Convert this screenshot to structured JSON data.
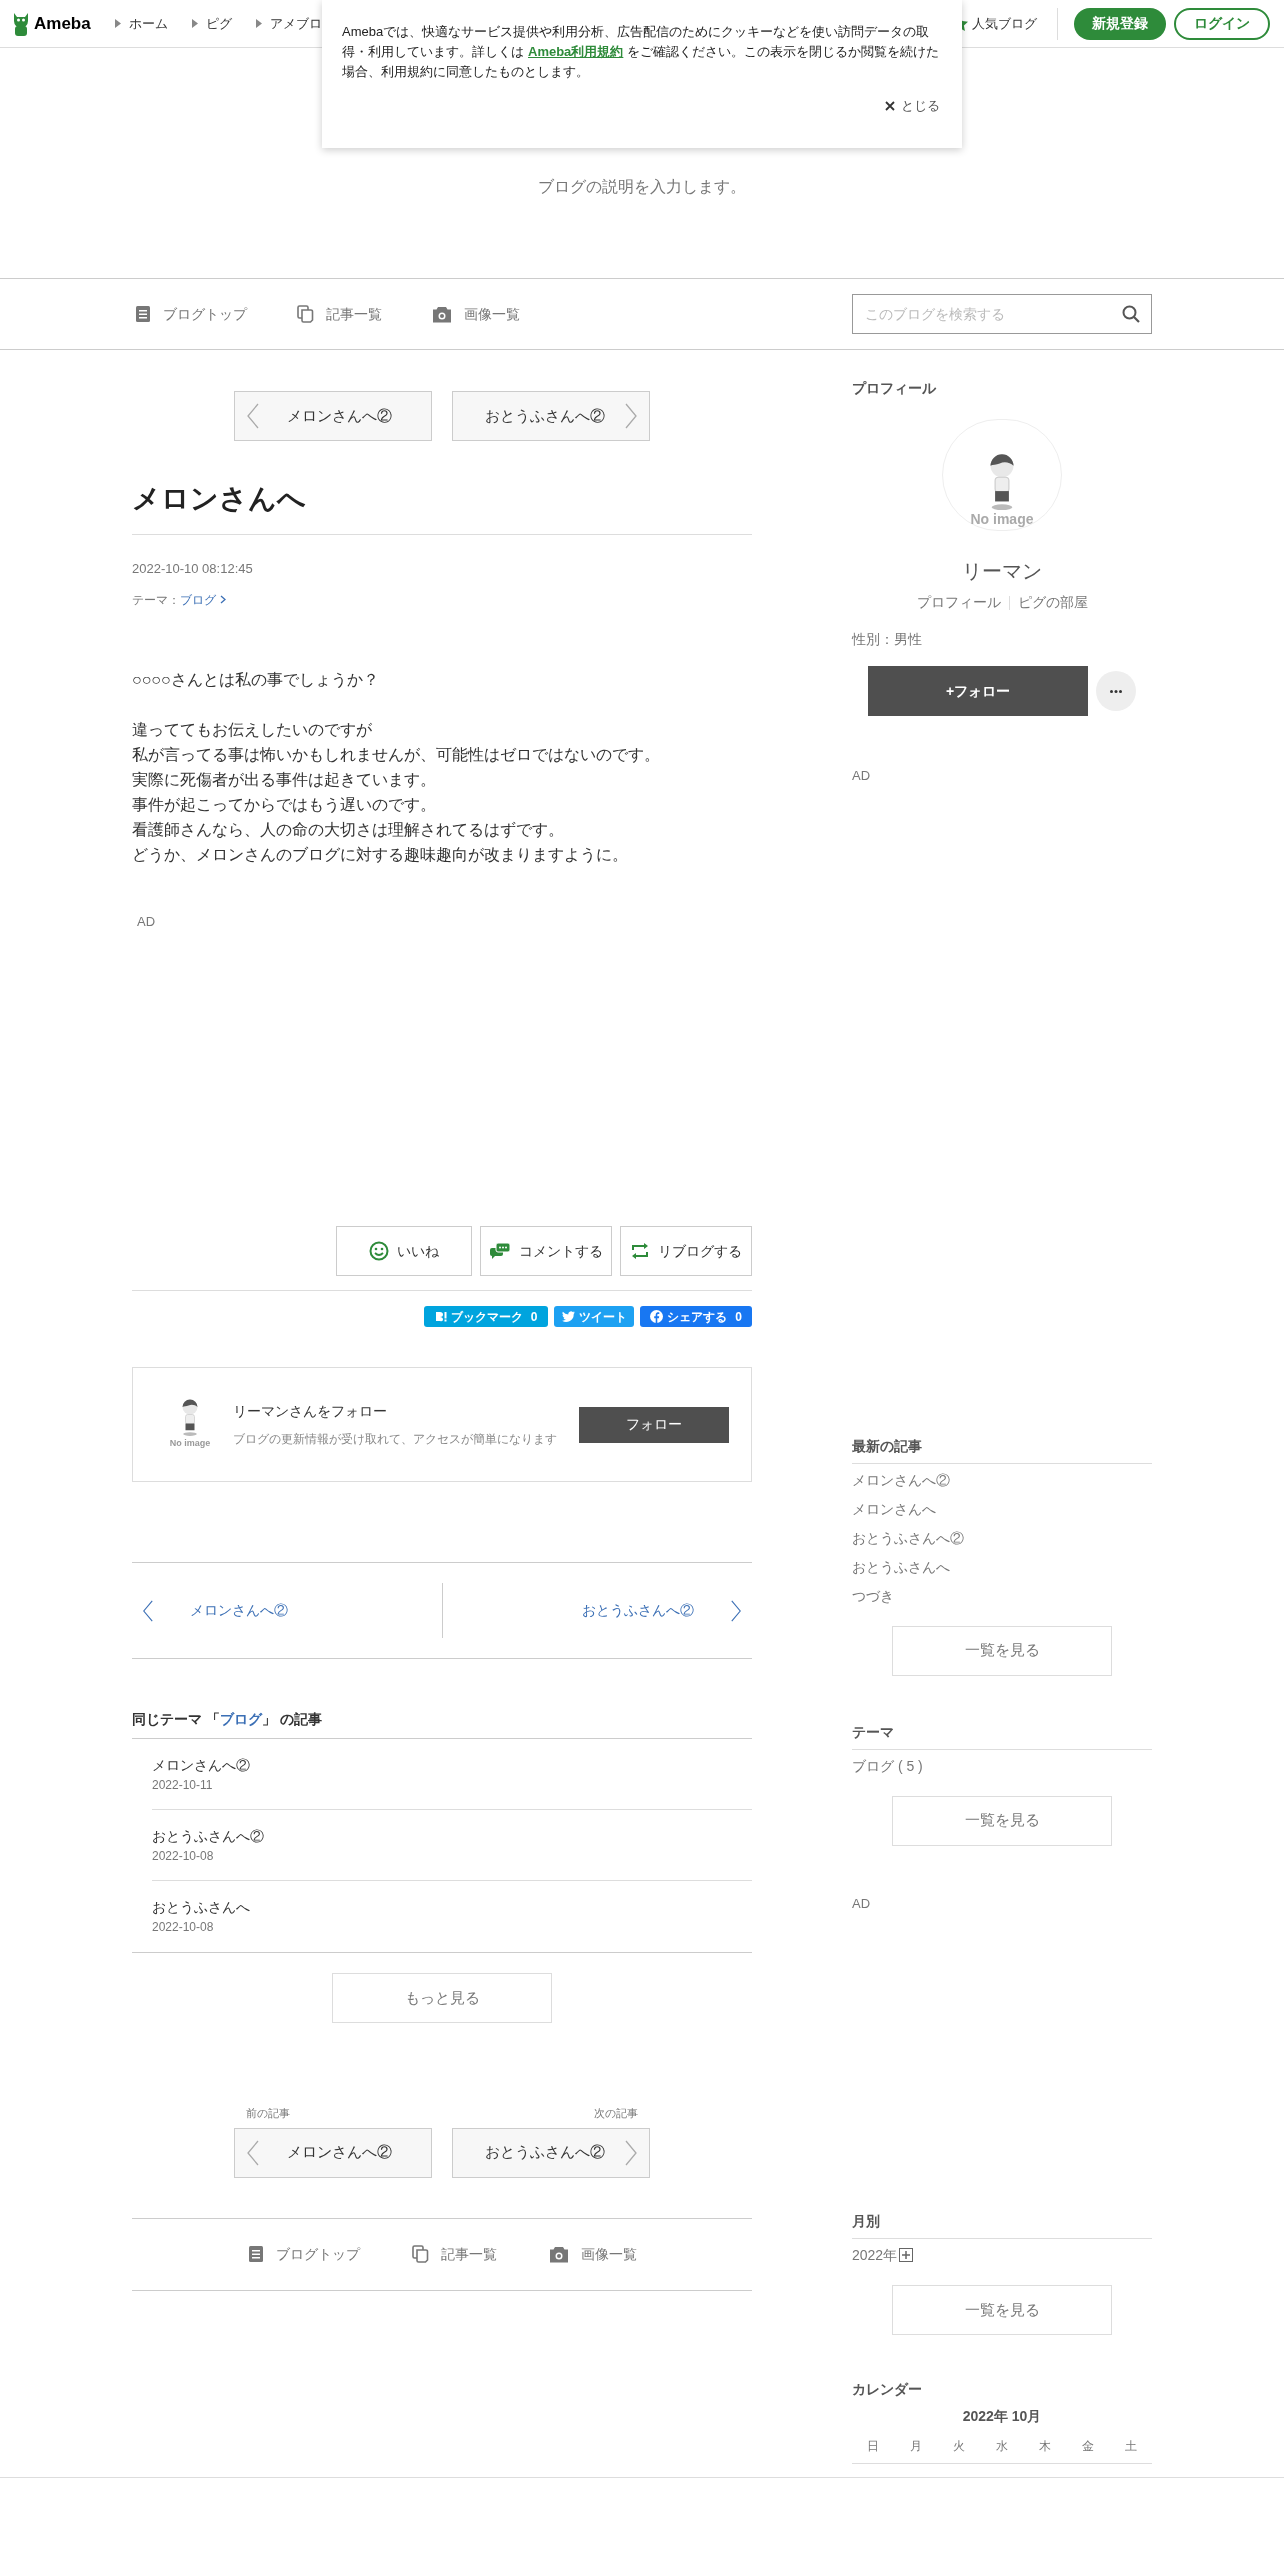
{
  "header": {
    "logo": "Ameba",
    "breadcrumbs": [
      "ホーム",
      "ピグ",
      "アメブロ"
    ],
    "popular": "人気ブログ",
    "signup": "新規登録",
    "login": "ログイン"
  },
  "cookie_banner": {
    "text_before": "Amebaでは、快適なサービス提供や利用分析、広告配信のためにクッキーなどを使い訪問データの取得・利用しています。詳しくは",
    "link": "Ameba利用規約",
    "text_after": "をご確認ください。この表示を閉じるか閲覧を続けた場合、利用規約に同意したものとします。",
    "close": "とじる"
  },
  "blog": {
    "description": "ブログの説明を入力します。"
  },
  "nav": {
    "items": [
      {
        "kind": "top",
        "label": "ブログトップ"
      },
      {
        "kind": "list",
        "label": "記事一覧"
      },
      {
        "kind": "image",
        "label": "画像一覧"
      }
    ],
    "search": {
      "placeholder": "このブログを検索する"
    }
  },
  "article": {
    "pager": {
      "prev": "メロンさんへ②",
      "next": "おとうふさんへ②"
    },
    "title": "メロンさんへ",
    "date": "2022-10-10 08:12:45",
    "theme_label": "テーマ：",
    "theme": "ブログ",
    "body": [
      {
        "lines": [
          "○○○○さんとは私の事でしょうか？"
        ]
      },
      {
        "lines": [
          "違っててもお伝えしたいのですが",
          "私が言ってる事は怖いかもしれませんが、可能性はゼロではないのです。",
          "実際に死傷者が出る事件は起きています。",
          "事件が起こってからではもう遅いのです。",
          "看護師さんなら、人の命の大切さは理解されてるはずです。",
          "どうか、メロンさんのブログに対する趣味趣向が改まりますように。"
        ]
      }
    ],
    "ad": "AD",
    "actions": [
      {
        "kind": "like",
        "label": "いいね"
      },
      {
        "kind": "comment",
        "label": "コメントする"
      },
      {
        "kind": "reblog",
        "label": "リブログする"
      }
    ],
    "share": [
      {
        "kind": "hatena",
        "label": "ブックマーク",
        "count": "0"
      },
      {
        "kind": "twitter",
        "label": "ツイート"
      },
      {
        "kind": "facebook",
        "label": "シェアする",
        "count": "0"
      }
    ],
    "follow_card": {
      "avatar_text": "No image",
      "title": "リーマンさんをフォロー",
      "description": "ブログの更新情報が受け取れて、アクセスが簡単になります",
      "button": "フォロー"
    },
    "article_nav": {
      "prev": "メロンさんへ②",
      "next": "おとうふさんへ②"
    }
  },
  "related": {
    "heading_before": "同じテーマ 「",
    "heading_theme": "ブログ",
    "heading_after": "」 の記事",
    "items": [
      {
        "title": "メロンさんへ②",
        "date": "2022-10-11"
      },
      {
        "title": "おとうふさんへ②",
        "date": "2022-10-08"
      },
      {
        "title": "おとうふさんへ",
        "date": "2022-10-08"
      }
    ],
    "more": "もっと見る"
  },
  "bottom_pager": {
    "prev_label": "前の記事",
    "next_label": "次の記事",
    "prev": "メロンさんへ②",
    "next": "おとうふさんへ②"
  },
  "bottom_nav": [
    {
      "kind": "top",
      "label": "ブログトップ"
    },
    {
      "kind": "list",
      "label": "記事一覧"
    },
    {
      "kind": "image",
      "label": "画像一覧"
    }
  ],
  "sidebar": {
    "profile": {
      "heading": "プロフィール",
      "avatar_text": "No image",
      "name": "リーマン",
      "links": [
        "プロフィール",
        "ピグの部屋"
      ],
      "gender": "性別：男性",
      "follow": "+フォロー"
    },
    "ad1": "AD",
    "latest": {
      "heading": "最新の記事",
      "items": [
        "メロンさんへ②",
        "メロンさんへ",
        "おとうふさんへ②",
        "おとうふさんへ",
        "つづき"
      ],
      "button": "一覧を見る"
    },
    "theme": {
      "heading": "テーマ",
      "items": [
        "ブログ ( 5 )"
      ],
      "button": "一覧を見る"
    },
    "ad2": "AD",
    "monthly": {
      "heading": "月別",
      "items": [
        "2022年"
      ],
      "button": "一覧を見る"
    },
    "calendar": {
      "heading": "カレンダー",
      "month": "2022年 10月",
      "weekdays": [
        "日",
        "月",
        "火",
        "水",
        "木",
        "金",
        "土"
      ]
    }
  }
}
